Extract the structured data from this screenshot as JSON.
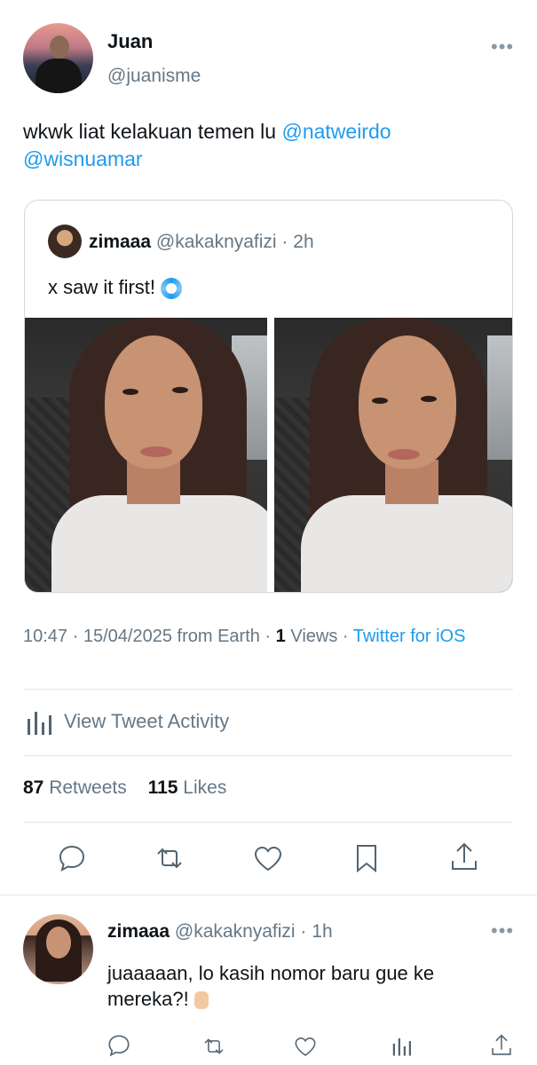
{
  "tweet": {
    "author_name": "Juan",
    "author_handle": "@juanisme",
    "more": "•••",
    "text_prefix": "wkwk liat kelakuan temen lu ",
    "mention1": "@natweirdo",
    "mention2": "@wisnuamar",
    "quote": {
      "author_name": "zimaaa",
      "author_handle": "@kakaknyafizi",
      "sep": " · ",
      "time": "2h",
      "text": "x saw it first!",
      "emoji": "cyclone-icon"
    },
    "meta": {
      "time": "10:47",
      "sep1": " · ",
      "date": "15/04/2025",
      "from": " from Earth",
      "sep2": " · ",
      "views_count": "1",
      "views_label": " Views",
      "sep3": " · ",
      "client": "Twitter for iOS"
    },
    "activity_label": "View Tweet Activity",
    "retweets_count": "87",
    "retweets_label": " Retweets",
    "likes_count": "115",
    "likes_label": " Likes"
  },
  "reply": {
    "author_name": "zimaaa",
    "author_handle": "@kakaknyafizi",
    "sep": " · ",
    "time": "1h",
    "more": "•••",
    "text": "juaaaaan, lo kasih nomor baru gue ke mereka?!",
    "emoji": "pointing-up-hand-icon"
  },
  "colors": {
    "link": "#1d9bf0",
    "muted": "#657786",
    "border": "#cfd9de"
  }
}
